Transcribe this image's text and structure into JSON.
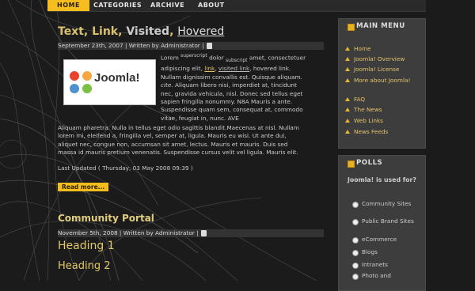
{
  "nav": {
    "items": [
      {
        "label": "HOME",
        "active": true
      },
      {
        "label": "CATEGORIES",
        "active": false
      },
      {
        "label": "ARCHIVE",
        "active": false
      },
      {
        "label": "ABOUT",
        "active": false
      }
    ]
  },
  "article1": {
    "title_parts": [
      "Text",
      "Link",
      "Visited",
      "Hovered"
    ],
    "meta": "September 23th, 2007 | Written by Administrator |",
    "logo_text": "Joomla!",
    "p1": {
      "lorem": "Lorem",
      "superscript": "superscript",
      "dolor": "dolor",
      "subscript": "subscript",
      "amet": "amet, consectetuer",
      "adip": "adipiscing elit,",
      "link": "link",
      "visited": "visited link",
      "hovered": ", hovered link.",
      "line3": "Nullam dignissim convallis est. Quisque aliquam.",
      "cite": "cite",
      "line4": ". Aliquam libero nisi, imperdiet at, tincidunt",
      "line5": "nec, gravida vehicula, nisl. Donec sed tellus eget",
      "line6": "sapien fringilla nonummy. N8A Mauris a ante.",
      "line7": "Suspendisse quam sem, consequat at, commodo",
      "line8": "vitae, feugiat in, nunc. AVE"
    },
    "p2": [
      "Aliquam pharetra. Nulla in tellus eget odio sagittis blandit.Maecenas at nisl. Nullam",
      "lorem mi, eleifend a, fringilla vel, semper at, ligula. Mauris eu wisi. Ut ante dui,",
      "aliquet nec, congue non, accumsan sit amet, lectus. Mauris et mauris. Duis sed",
      "massa id mauris pretium venenatis. Suspendisse cursus velit vel ligula. Mauris elit."
    ],
    "last_updated": "Last Updated ( Thursday, 03 May 2008 09:39 )",
    "read_more": "Read more..."
  },
  "article2": {
    "title": "Community Portal",
    "meta": "November 5th, 2008 | Written by Administrator |",
    "heading1": "Heading 1",
    "heading2": "Heading 2"
  },
  "main_menu": {
    "title": "MAIN MENU",
    "items": [
      "Home",
      "Joomla! Overview",
      "Joomla! License",
      "More about Joomla!",
      "FAQ",
      "The News",
      "Web Links",
      "News Feeds"
    ]
  },
  "polls": {
    "title": "POLLS",
    "question": "Joomla! is used for?",
    "options": [
      "Community Sites",
      "Public Brand Sites",
      "eCommerce",
      "Blogs",
      "Intranets",
      "Photo and"
    ]
  },
  "colors": {
    "accent": "#f5bd1e",
    "title": "#d8c06e",
    "link": "#e6c36a",
    "background": "#1b1b1b"
  }
}
